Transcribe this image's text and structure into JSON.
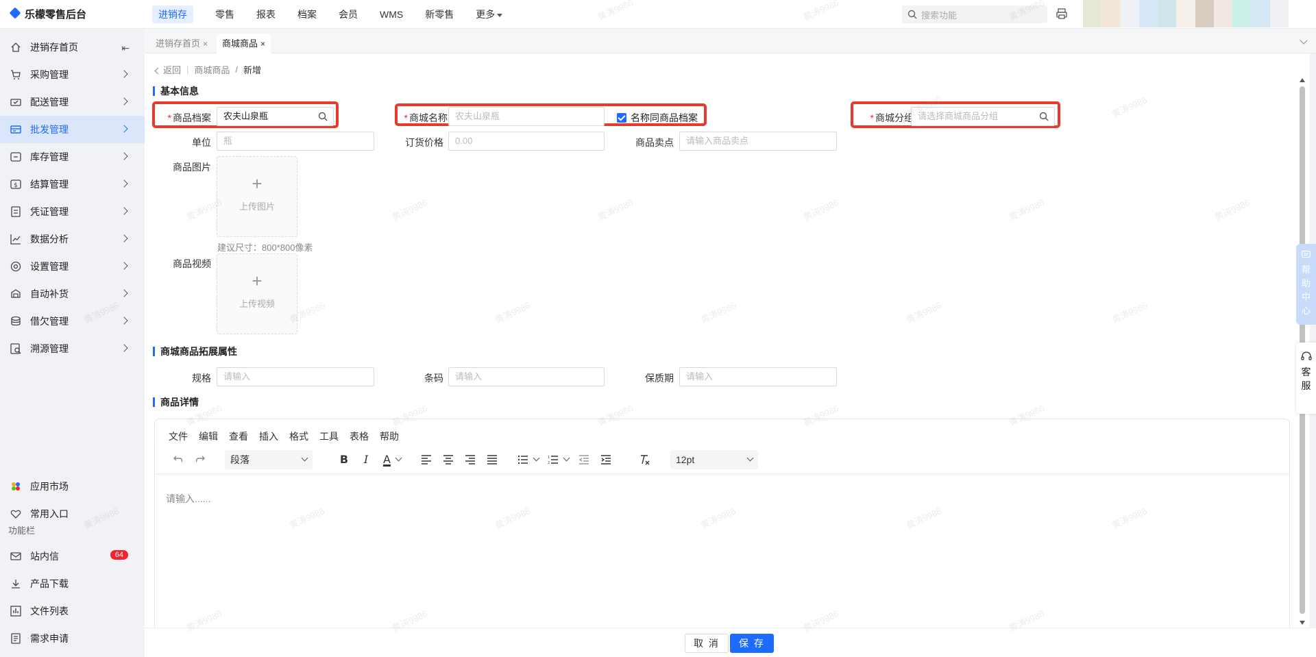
{
  "app": {
    "title": "乐檬零售后台"
  },
  "topnav": {
    "items": [
      {
        "label": "进销存"
      },
      {
        "label": "零售"
      },
      {
        "label": "报表"
      },
      {
        "label": "档案"
      },
      {
        "label": "会员"
      },
      {
        "label": "WMS"
      },
      {
        "label": "新零售"
      },
      {
        "label": "更多"
      }
    ],
    "search_placeholder": "搜索功能"
  },
  "sidebar": {
    "items": [
      {
        "label": "进销存首页"
      },
      {
        "label": "采购管理"
      },
      {
        "label": "配送管理"
      },
      {
        "label": "批发管理"
      },
      {
        "label": "库存管理"
      },
      {
        "label": "结算管理"
      },
      {
        "label": "凭证管理"
      },
      {
        "label": "数据分析"
      },
      {
        "label": "设置管理"
      },
      {
        "label": "自动补货"
      },
      {
        "label": "借欠管理"
      },
      {
        "label": "溯源管理"
      }
    ],
    "bottom_items": [
      {
        "label": "应用市场"
      },
      {
        "label": "常用入口"
      }
    ],
    "section_label": "功能栏",
    "func_items": [
      {
        "label": "站内信",
        "badge": "64"
      },
      {
        "label": "产品下载"
      },
      {
        "label": "文件列表"
      },
      {
        "label": "需求申请"
      }
    ]
  },
  "tabs": [
    {
      "label": "进销存首页",
      "close": "×"
    },
    {
      "label": "商城商品",
      "close": "×"
    }
  ],
  "breadcrumb": {
    "back": "返回",
    "parent": "商城商品",
    "sep": "/",
    "current": "新增"
  },
  "form": {
    "basic_title": "基本信息",
    "product_file": {
      "label": "商品档案",
      "value": "农夫山泉瓶"
    },
    "mall_name": {
      "label": "商城名称",
      "placeholder": "农夫山泉瓶",
      "checkbox_label": "名称同商品档案"
    },
    "mall_group": {
      "label": "商城分组",
      "placeholder": "请选择商城商品分组"
    },
    "unit": {
      "label": "单位",
      "placeholder": "瓶"
    },
    "order_price": {
      "label": "订货价格",
      "placeholder": "0.00"
    },
    "selling_point": {
      "label": "商品卖点",
      "placeholder": "请输入商品卖点"
    },
    "image": {
      "label": "商品图片",
      "upload_text": "上传图片",
      "hint": "建议尺寸：800*800像素"
    },
    "video": {
      "label": "商品视频",
      "upload_text": "上传视频"
    },
    "ext_title": "商城商品拓展属性",
    "spec": {
      "label": "规格",
      "placeholder": "请输入"
    },
    "barcode": {
      "label": "条码",
      "placeholder": "请输入"
    },
    "shelf_life": {
      "label": "保质期",
      "placeholder": "请输入"
    },
    "detail_title": "商品详情"
  },
  "editor": {
    "menus": [
      "文件",
      "编辑",
      "查看",
      "插入",
      "格式",
      "工具",
      "表格",
      "帮助"
    ],
    "block_format": "段落",
    "font_size": "12pt",
    "placeholder": "请输入......"
  },
  "float": {
    "help": [
      "帮",
      "助",
      "中",
      "心"
    ],
    "service": [
      "客",
      "服"
    ]
  },
  "actions": {
    "cancel": "取 消",
    "save": "保 存"
  },
  "watermark": "黄涛9986",
  "colors": {
    "accent": "#1e6bff",
    "highlight": "#e53b2c",
    "badge": "#f5222d"
  }
}
